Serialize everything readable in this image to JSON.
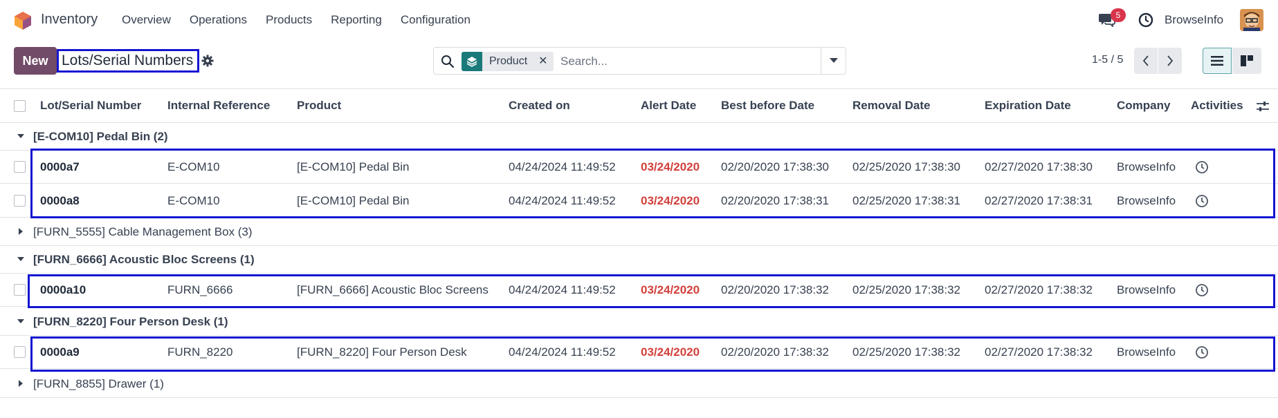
{
  "navbar": {
    "app_name": "Inventory",
    "menu": [
      "Overview",
      "Operations",
      "Products",
      "Reporting",
      "Configuration"
    ],
    "chat_badge": "5",
    "company": "BrowseInfo",
    "icons": {
      "chat": "chat-icon",
      "clock": "clock-icon",
      "logo": "inventory-logo-icon"
    }
  },
  "control_panel": {
    "new_label": "New",
    "breadcrumb": "Lots/Serial Numbers",
    "search": {
      "facet_label": "Product",
      "placeholder": "Search..."
    },
    "pager": "1-5 / 5"
  },
  "table": {
    "columns": [
      "Lot/Serial Number",
      "Internal Reference",
      "Product",
      "Created on",
      "Alert Date",
      "Best before Date",
      "Removal Date",
      "Expiration Date",
      "Company",
      "Activities"
    ],
    "groups": [
      {
        "label": "[E-COM10] Pedal Bin (2)",
        "expanded": true,
        "rows": [
          {
            "lot": "0000a7",
            "ref": "E-COM10",
            "product": "[E-COM10] Pedal Bin",
            "created": "04/24/2024 11:49:52",
            "alert": "03/24/2020",
            "best_before": "02/20/2020 17:38:30",
            "removal": "02/25/2020 17:38:30",
            "expiration": "02/27/2020 17:38:30",
            "company": "BrowseInfo"
          },
          {
            "lot": "0000a8",
            "ref": "E-COM10",
            "product": "[E-COM10] Pedal Bin",
            "created": "04/24/2024 11:49:52",
            "alert": "03/24/2020",
            "best_before": "02/20/2020 17:38:31",
            "removal": "02/25/2020 17:38:31",
            "expiration": "02/27/2020 17:38:31",
            "company": "BrowseInfo"
          }
        ]
      },
      {
        "label": "[FURN_5555] Cable Management Box (3)",
        "expanded": false,
        "rows": []
      },
      {
        "label": "[FURN_6666] Acoustic Bloc Screens (1)",
        "expanded": true,
        "rows": [
          {
            "lot": "0000a10",
            "ref": "FURN_6666",
            "product": "[FURN_6666] Acoustic Bloc Screens",
            "created": "04/24/2024 11:49:52",
            "alert": "03/24/2020",
            "best_before": "02/20/2020 17:38:32",
            "removal": "02/25/2020 17:38:32",
            "expiration": "02/27/2020 17:38:32",
            "company": "BrowseInfo"
          }
        ]
      },
      {
        "label": "[FURN_8220] Four Person Desk (1)",
        "expanded": true,
        "rows": [
          {
            "lot": "0000a9",
            "ref": "FURN_8220",
            "product": "[FURN_8220] Four Person Desk",
            "created": "04/24/2024 11:49:52",
            "alert": "03/24/2020",
            "best_before": "02/20/2020 17:38:32",
            "removal": "02/25/2020 17:38:32",
            "expiration": "02/27/2020 17:38:32",
            "company": "BrowseInfo"
          }
        ]
      },
      {
        "label": "[FURN_8855] Drawer (1)",
        "expanded": false,
        "rows": []
      }
    ]
  },
  "colors": {
    "brand": "#714b67",
    "alert": "#d23f3a",
    "highlight": "#1414d2",
    "facet": "#1a7a7a"
  }
}
